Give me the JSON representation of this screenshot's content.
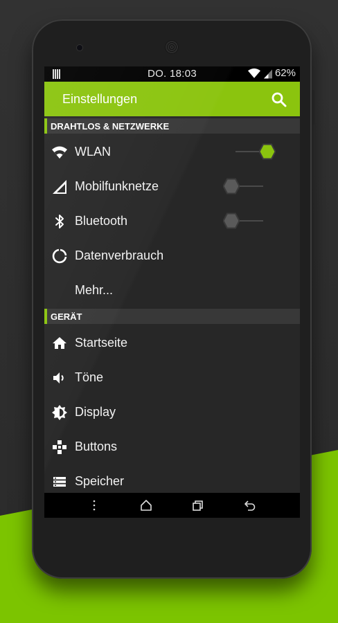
{
  "status_bar": {
    "time": "DO. 18:03",
    "battery": "62%"
  },
  "app_bar": {
    "title": "Einstellungen"
  },
  "sections": {
    "wireless": {
      "label": "DRAHTLOS & NETZWERKE"
    },
    "device": {
      "label": "GERÄT"
    }
  },
  "items": {
    "wlan": {
      "label": "WLAN",
      "icon": "wifi-icon",
      "toggle": "on"
    },
    "mobile": {
      "label": "Mobilfunknetze",
      "icon": "cell-signal-icon",
      "toggle": "off"
    },
    "bluetooth": {
      "label": "Bluetooth",
      "icon": "bluetooth-icon",
      "toggle": "off"
    },
    "data": {
      "label": "Datenverbrauch",
      "icon": "data-usage-icon"
    },
    "more": {
      "label": "Mehr..."
    },
    "home": {
      "label": "Startseite",
      "icon": "home-icon"
    },
    "sound": {
      "label": "Töne",
      "icon": "volume-icon"
    },
    "display": {
      "label": "Display",
      "icon": "brightness-icon"
    },
    "buttons": {
      "label": "Buttons",
      "icon": "gamepad-icon"
    },
    "storage": {
      "label": "Speicher",
      "icon": "storage-icon"
    }
  },
  "colors": {
    "accent": "#8bc40e",
    "background_green": "#7cc400",
    "screen_bg": "#272727",
    "section_bg": "#383838"
  }
}
